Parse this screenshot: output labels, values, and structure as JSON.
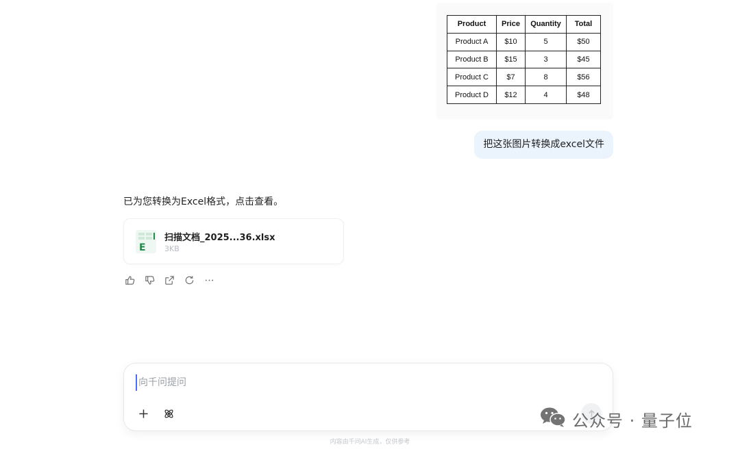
{
  "uploaded_image": {
    "headers": [
      "Product",
      "Price",
      "Quantity",
      "Total"
    ],
    "rows": [
      [
        "Product A",
        "$10",
        "5",
        "$50"
      ],
      [
        "Product B",
        "$15",
        "3",
        "$45"
      ],
      [
        "Product C",
        "$7",
        "8",
        "$56"
      ],
      [
        "Product D",
        "$12",
        "4",
        "$48"
      ]
    ]
  },
  "user_message": "把这张图片转换成excel文件",
  "assistant": {
    "reply": "已为您转换为Excel格式，点击查看。",
    "file": {
      "icon_letter": "E",
      "name": "扫描文档_2025...36.xlsx",
      "size": "3KB"
    },
    "actions": [
      "thumbs-up-icon",
      "thumbs-down-icon",
      "share-icon",
      "refresh-icon",
      "more-icon"
    ]
  },
  "input": {
    "placeholder": "向千问提问",
    "value": ""
  },
  "disclaimer": "内容由千问AI生成，仅供参考",
  "watermark": {
    "text": "公众号 · 量子位"
  },
  "colors": {
    "user_bubble": "#ebf3fd",
    "excel_green": "#1f8a4c",
    "cursor": "#4a6cf7"
  }
}
